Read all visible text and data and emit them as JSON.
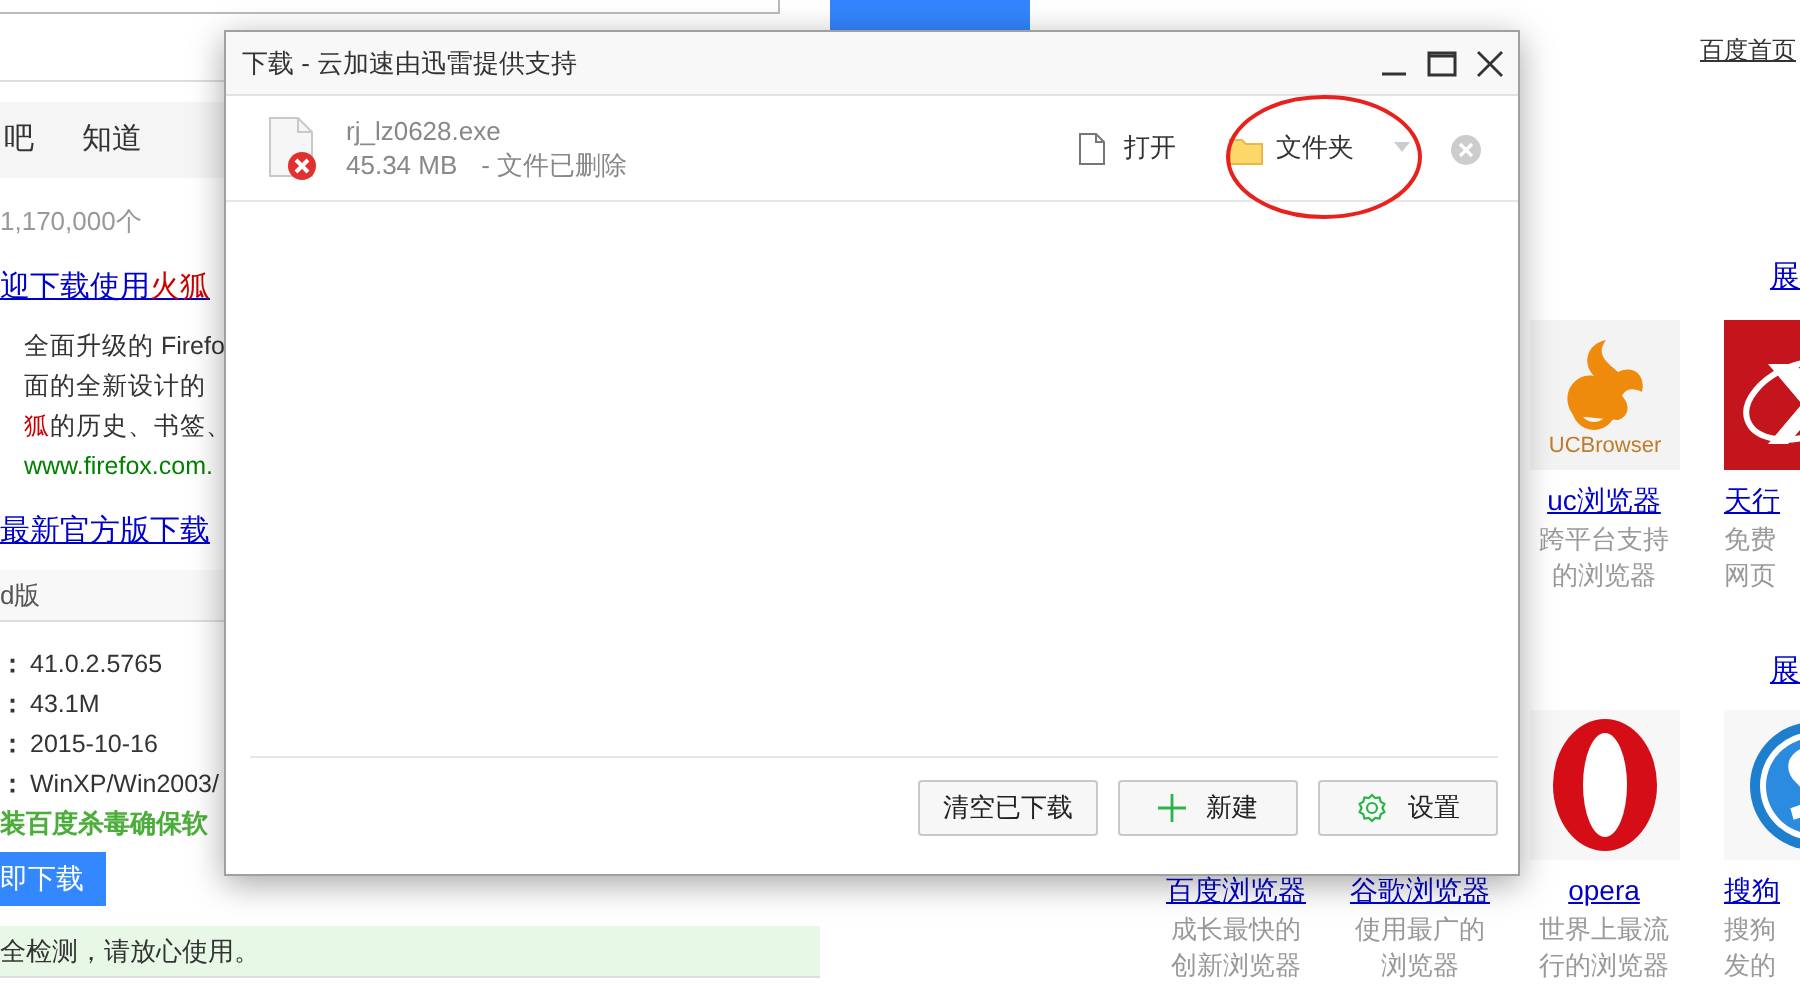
{
  "page": {
    "home_link": "百度首页",
    "nav_tabs": [
      {
        "label": "吧"
      },
      {
        "label": "知道"
      }
    ],
    "result_count": "1,170,000个",
    "result_title": [
      {
        "text": "迎下载使用",
        "highlight": false
      },
      {
        "text": "火狐",
        "highlight": true
      }
    ],
    "snippet": [
      [
        {
          "text": "全面升级的 Firefo",
          "highlight": false
        }
      ],
      [
        {
          "text": "面的全新设计的",
          "highlight": false
        }
      ],
      [
        {
          "text": "狐",
          "highlight": true
        },
        {
          "text": "的历史、书签、",
          "highlight": false
        }
      ]
    ],
    "url": "www.firefox.com.",
    "result2_title": "最新官方版下载",
    "version_tab": "d版",
    "details": [
      {
        "label": "：",
        "value": "41.0.2.5765"
      },
      {
        "label": "：",
        "value": "43.1M"
      },
      {
        "label": "：",
        "value": "2015-10-16"
      },
      {
        "label": "：",
        "value": "WinXP/Win2003/"
      }
    ],
    "notice": "装百度杀毒确保软",
    "download_button": "即下载",
    "safety_note": "全检测，请放心使用。",
    "sections": [
      {
        "more_link": "展",
        "items": [
          {
            "kind": "uc",
            "logo_text": "UCBrowser",
            "link": "uc浏览器",
            "desc": [
              "跨平台支持",
              "的浏览器"
            ]
          },
          {
            "kind": "red-x",
            "link": "天行",
            "desc": [
              "免费",
              "网页"
            ]
          }
        ]
      },
      {
        "more_link": "展",
        "items": [
          {
            "link": "百度浏览器",
            "desc": [
              "成长最快的",
              "创新浏览器"
            ]
          },
          {
            "link": "谷歌浏览器",
            "desc": [
              "使用最广的",
              "浏览器"
            ]
          },
          {
            "kind": "opera",
            "link": "opera",
            "desc": [
              "世界上最流",
              "行的浏览器"
            ]
          },
          {
            "kind": "sogou",
            "link": "搜狗",
            "desc": [
              "搜狗",
              "发的"
            ]
          }
        ]
      }
    ]
  },
  "dialog": {
    "title": "下载 - 云加速由迅雷提供支持",
    "downloads": [
      {
        "name": "rj_lz0628.exe",
        "size": "45.34 MB",
        "status": "- 文件已删除",
        "failed": true,
        "actions": [
          {
            "kind": "open",
            "label": "打开"
          },
          {
            "kind": "folder",
            "label": "文件夹"
          }
        ]
      }
    ],
    "footer_buttons": [
      {
        "kind": "clear",
        "label": "清空已下载"
      },
      {
        "kind": "new",
        "label": "新建"
      },
      {
        "kind": "settings",
        "label": "设置"
      }
    ]
  }
}
